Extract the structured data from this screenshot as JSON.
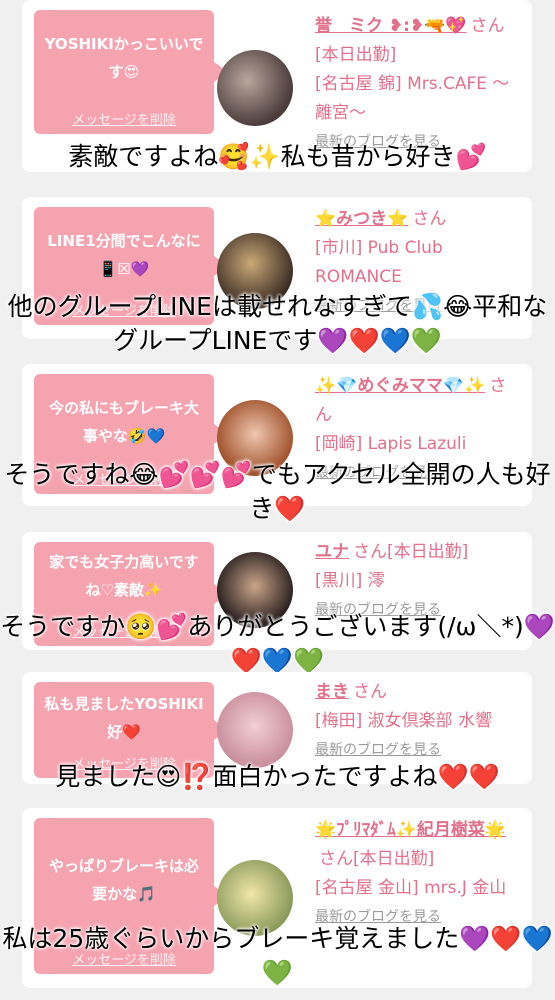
{
  "delete_label": "メッセージを削除",
  "blog_label": "最新のブログを見る",
  "san": "さん",
  "cards": [
    {
      "message": "YOSHIKIかっこいいです😍",
      "name": "誉　ミク ❥:❥🔫💖",
      "status": "[本日出勤]",
      "shop": "[名古屋 錦] Mrs.CAFE ～離宮～",
      "caption": "素敵ですよね🥰✨私も昔から好き💕"
    },
    {
      "message": "LINE1分間でこんなに📱☒💜",
      "name": "⭐みつき⭐",
      "status": "",
      "shop": "[市川] Pub Club ROMANCE",
      "caption": "他のグループLINEは載せれなすぎて💦😂平和なグループLINEです💜❤️💙💚"
    },
    {
      "message": "今の私にもブレーキ大事やな🤣💙",
      "name": "✨💎めぐみママ💎✨",
      "status": "",
      "shop": "[岡崎] Lapis Lazuli",
      "caption": "そうですね😂💕💕💕でもアクセル全開の人も好き❤️"
    },
    {
      "message": "家でも女子力高いですね♡素敵✨",
      "name": "ユナ",
      "status": "[本日出勤]",
      "shop": "[黒川] 澪",
      "caption": "そうですか🥺💕ありがとうございます(/ω＼*)💜❤️💙💚"
    },
    {
      "message": "私も見ましたYOSHIKI好❤️",
      "name": "まき",
      "status": "",
      "shop": "[梅田] 淑女倶楽部 水響",
      "caption": "見ました😍⁉️面白かったですよね❤️❤️"
    },
    {
      "message": "やっぱりブレーキは必要かな🎵",
      "name": "🌟ﾌﾟﾘﾏﾀﾞﾑ✨紀月樹菜🌟",
      "status": "[本日出勤]",
      "shop": "[名古屋 金山] mrs.J 金山",
      "caption": "私は25歳ぐらいからブレーキ覚えました💜❤️💙💚"
    }
  ]
}
